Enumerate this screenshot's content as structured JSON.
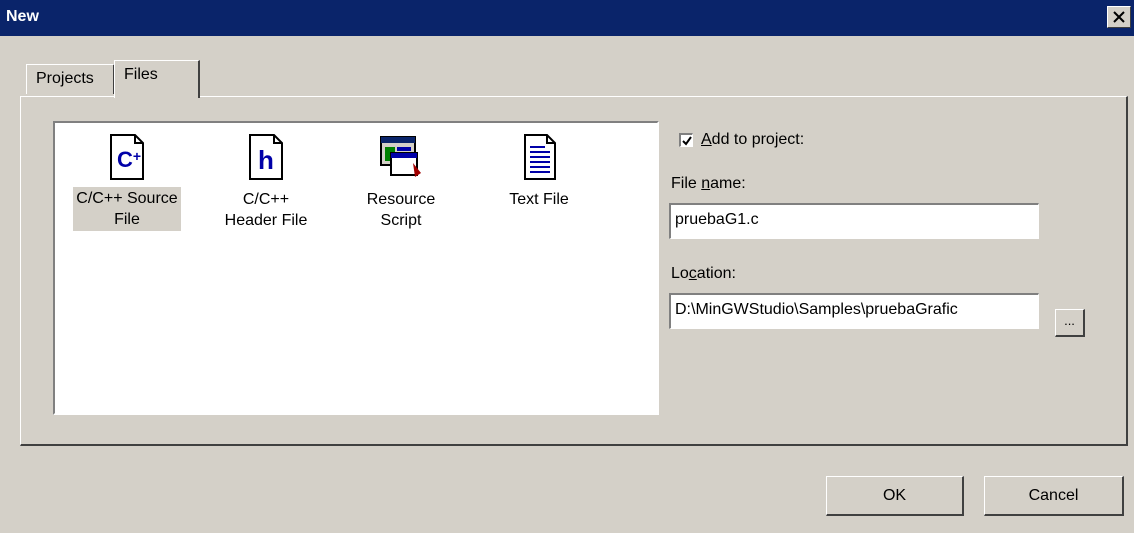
{
  "window": {
    "title": "New",
    "close_label": "×"
  },
  "tabs": [
    {
      "label": "Projects",
      "selected": false
    },
    {
      "label": "Files",
      "selected": true
    }
  ],
  "file_types": [
    {
      "label_line1": "C/C++ Source",
      "label_line2": "File",
      "icon": "c-source-file-icon",
      "icon_text": "C‡",
      "selected": true
    },
    {
      "label_line1": "C/C++",
      "label_line2": "Header File",
      "icon": "header-file-icon",
      "icon_text": "h",
      "selected": false
    },
    {
      "label_line1": "Resource",
      "label_line2": "Script",
      "icon": "resource-script-icon",
      "selected": false
    },
    {
      "label_line1": "Text File",
      "label_line2": "",
      "icon": "text-file-icon",
      "selected": false
    }
  ],
  "add_to_project": {
    "checked": true,
    "label_prefix": "",
    "label_accel": "A",
    "label_rest": "dd to project:"
  },
  "file_name": {
    "label_prefix": "File ",
    "label_accel": "n",
    "label_rest": "ame:",
    "value": "pruebaG1.c"
  },
  "location": {
    "label_prefix": "Lo",
    "label_accel": "c",
    "label_rest": "ation:",
    "value": "D:\\MinGWStudio\\Samples\\pruebaGrafic"
  },
  "buttons": {
    "browse": "...",
    "ok": "OK",
    "cancel": "Cancel"
  },
  "colors": {
    "titlebar": "#0a246a",
    "face": "#d4d0c8",
    "icon_blue": "#0000a8"
  }
}
